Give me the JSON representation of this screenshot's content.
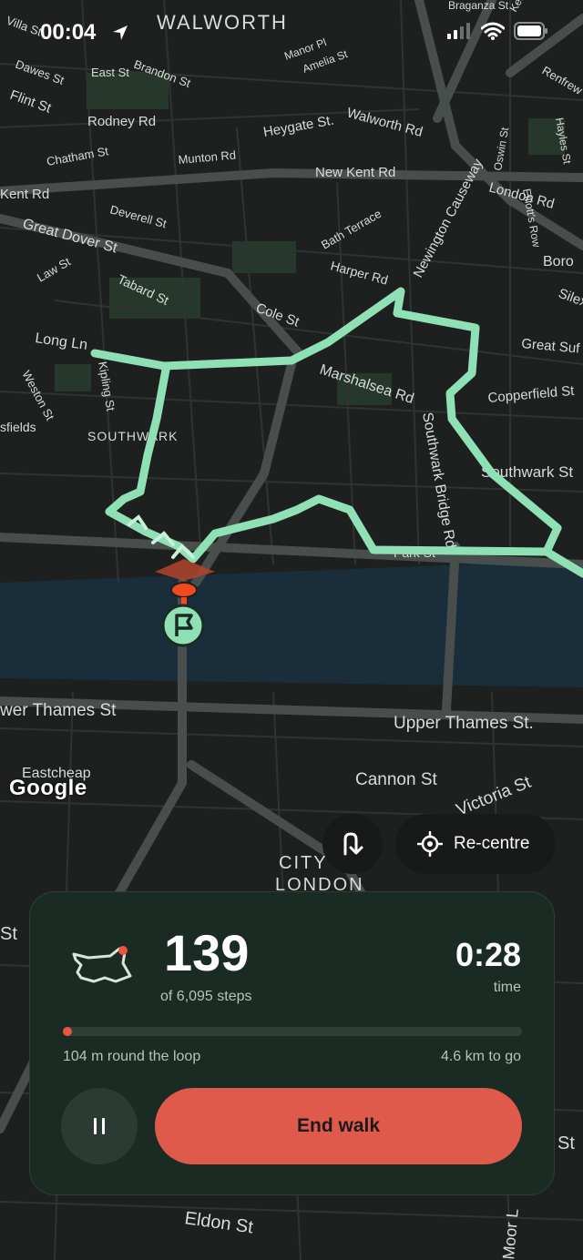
{
  "status_bar": {
    "time": "00:04",
    "location_icon": "location-arrow-icon",
    "signal_icon": "cellular-signal-icon",
    "wifi_icon": "wifi-icon",
    "battery_icon": "battery-icon"
  },
  "map": {
    "attribution": "Google",
    "labels": [
      "WALWORTH",
      "Villa St",
      "Braganza St",
      "Ken",
      "Manor Pl",
      "Amelia St",
      "Dawes St",
      "East St",
      "Brandon St",
      "Renfrew R",
      "Flint St",
      "Rodney Rd",
      "Heygate St.",
      "Walworth Rd",
      "Oswin St",
      "Elliott's Row",
      "Hayles St",
      "Chatham St",
      "Munton Rd",
      "New Kent Rd",
      "London Rd",
      "Kent Rd",
      "Deverell St",
      "Newington Causeway",
      "Bath Terrace",
      "Great Dover St",
      "Boro",
      "Law St",
      "Harper Rd",
      "Silex",
      "Tabard St",
      "Cole St",
      "Great Suf",
      "Long Ln",
      "Marshalsea Rd",
      "Copperfield St",
      "Weston St",
      "Kipling St",
      "sfields",
      "SOUTHWARK",
      "Southwark St",
      "Southwark Bridge Rd",
      "Park St",
      "wer Thames St",
      "Upper Thames St.",
      "Eastcheap",
      "Cannon St",
      "Victoria St",
      "CITY",
      "LONDON",
      "St",
      "Eldon St",
      "Moor L"
    ],
    "route_color": "#8fe0b5",
    "start_marker_icon": "start-flag-icon"
  },
  "map_controls": {
    "reroute_icon": "reroute-arrow-icon",
    "recentre_icon": "crosshair-icon",
    "recentre_label": "Re-centre"
  },
  "walk_panel": {
    "loop_icon": "loop-route-icon",
    "steps_value": "139",
    "steps_caption": "of 6,095 steps",
    "time_value": "0:28",
    "time_caption": "time",
    "progress_fraction": 0.017,
    "progress_left": "104 m round the loop",
    "progress_right": "4.6 km to go",
    "pause_icon": "pause-icon",
    "end_label": "End walk",
    "accent_color": "#e05a4c"
  }
}
